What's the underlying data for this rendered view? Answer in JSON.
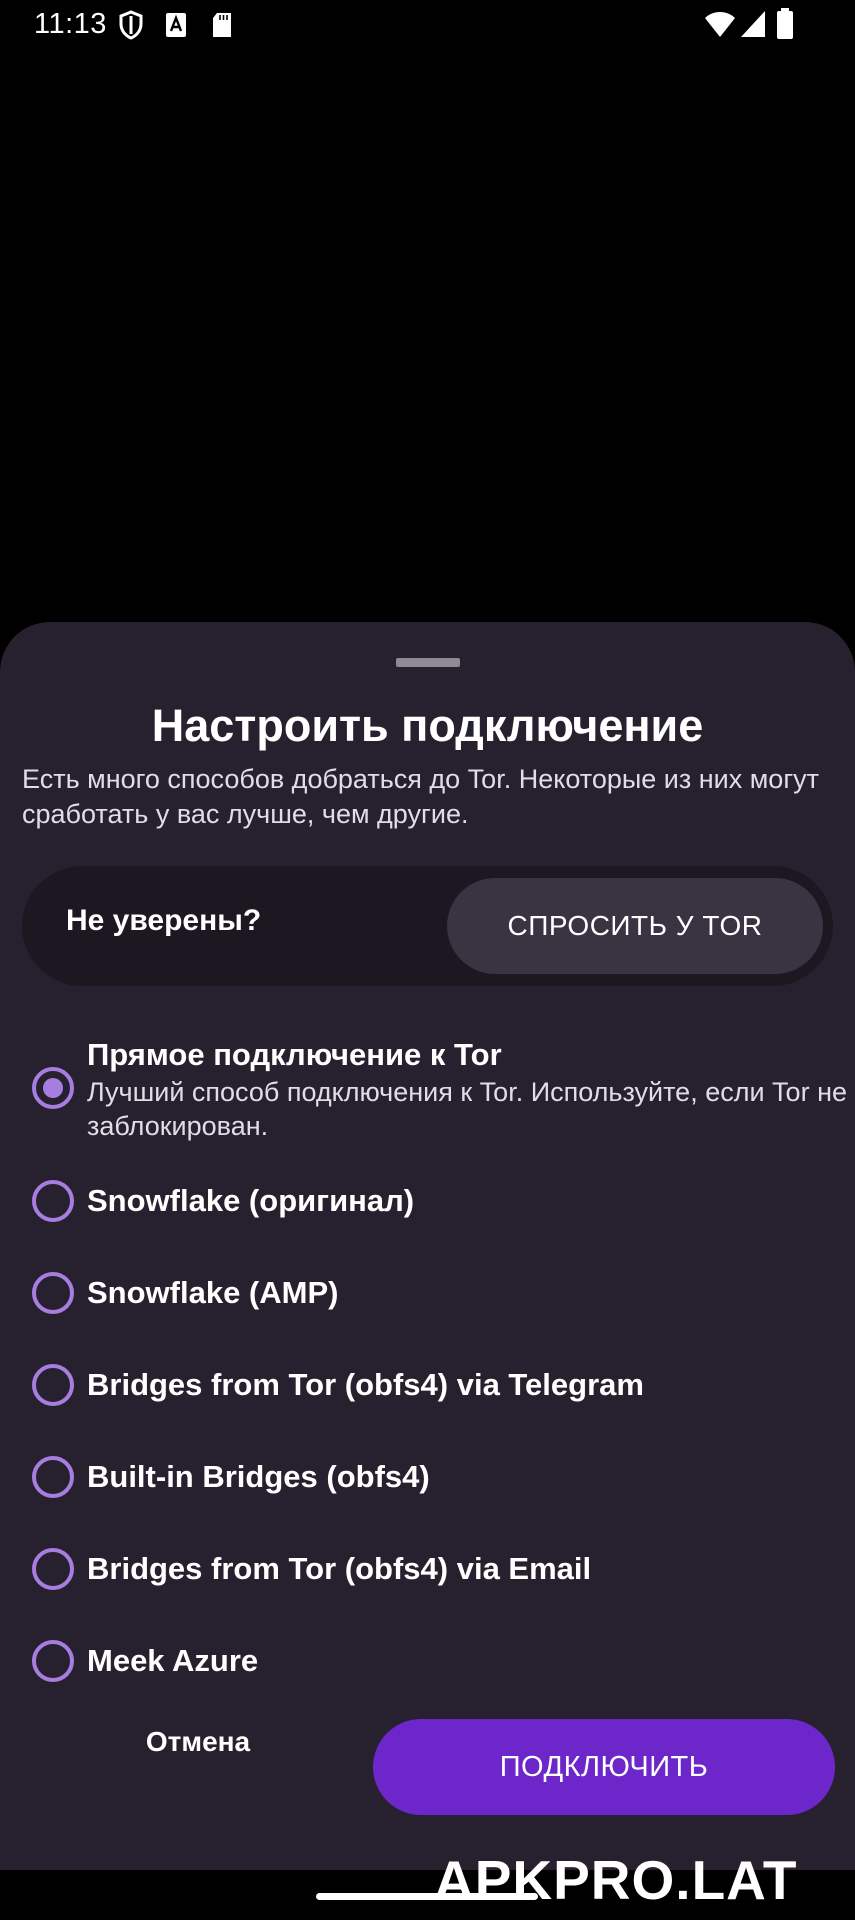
{
  "status_bar": {
    "time": "11:13",
    "icons": [
      "shield-icon",
      "font-icon",
      "sd-card-icon",
      "wifi-icon",
      "signal-icon",
      "battery-icon"
    ]
  },
  "sheet": {
    "title": "Настроить подключение",
    "description": "Есть много способов добраться до Tor. Некоторые из них могут сработать у вас лучше, чем другие.",
    "not_sure": {
      "label": "Не уверены?",
      "button": "СПРОСИТЬ У TOR"
    },
    "options": [
      {
        "label": "Прямое подключение к Tor",
        "description": "Лучший способ подключения к Tor. Используйте, если Tor не заблокирован.",
        "selected": true
      },
      {
        "label": "Snowflake (оригинал)",
        "selected": false
      },
      {
        "label": "Snowflake (AMP)",
        "selected": false
      },
      {
        "label": "Bridges from Tor (obfs4) via Telegram",
        "selected": false
      },
      {
        "label": "Built-in Bridges (obfs4)",
        "selected": false
      },
      {
        "label": "Bridges from Tor (obfs4) via Email",
        "selected": false
      },
      {
        "label": "Meek Azure",
        "selected": false
      }
    ],
    "cancel": "Отмена",
    "connect": "ПОДКЛЮЧИТЬ"
  },
  "watermark": "APKPRO.LAT",
  "colors": {
    "sheet_bg": "#27212f",
    "accent": "#a87de0",
    "connect_bg": "#6d26c9"
  }
}
